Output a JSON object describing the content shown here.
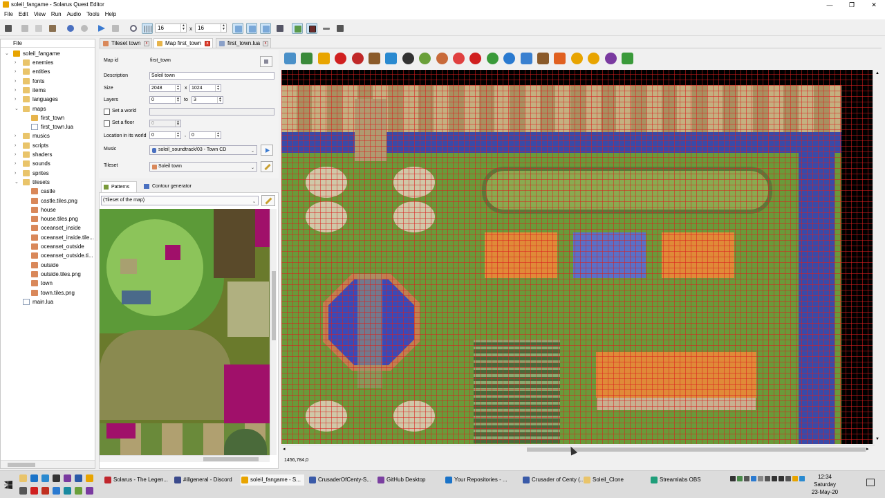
{
  "window": {
    "title": "soleil_fangame - Solarus Quest Editor",
    "min": "—",
    "max": "❐",
    "close": "✕"
  },
  "menu": [
    "File",
    "Edit",
    "View",
    "Run",
    "Audio",
    "Tools",
    "Help"
  ],
  "toolbar": {
    "grid_w": "16",
    "grid_h": "16",
    "x_label": "x"
  },
  "tree": {
    "header": "File",
    "root": "soleil_fangame",
    "items": [
      {
        "label": "enemies",
        "level": 1,
        "kind": "folder",
        "arrow": "›"
      },
      {
        "label": "entities",
        "level": 1,
        "kind": "folder",
        "arrow": "›"
      },
      {
        "label": "fonts",
        "level": 1,
        "kind": "folder",
        "arrow": "›"
      },
      {
        "label": "items",
        "level": 1,
        "kind": "folder",
        "arrow": "›"
      },
      {
        "label": "languages",
        "level": 1,
        "kind": "folder",
        "arrow": "›"
      },
      {
        "label": "maps",
        "level": 1,
        "kind": "folder",
        "arrow": "⌄"
      },
      {
        "label": "first_town",
        "level": 2,
        "kind": "map",
        "arrow": ""
      },
      {
        "label": "first_town.lua",
        "level": 2,
        "kind": "file",
        "arrow": ""
      },
      {
        "label": "musics",
        "level": 1,
        "kind": "folder",
        "arrow": "›"
      },
      {
        "label": "scripts",
        "level": 1,
        "kind": "folder",
        "arrow": "›"
      },
      {
        "label": "shaders",
        "level": 1,
        "kind": "folder",
        "arrow": "›"
      },
      {
        "label": "sounds",
        "level": 1,
        "kind": "folder",
        "arrow": "›"
      },
      {
        "label": "sprites",
        "level": 1,
        "kind": "folder",
        "arrow": "›"
      },
      {
        "label": "tilesets",
        "level": 1,
        "kind": "folder",
        "arrow": "⌄"
      },
      {
        "label": "castle",
        "level": 2,
        "kind": "img",
        "arrow": ""
      },
      {
        "label": "castle.tiles.png",
        "level": 2,
        "kind": "img",
        "arrow": ""
      },
      {
        "label": "house",
        "level": 2,
        "kind": "img",
        "arrow": ""
      },
      {
        "label": "house.tiles.png",
        "level": 2,
        "kind": "img",
        "arrow": ""
      },
      {
        "label": "oceanset_inside",
        "level": 2,
        "kind": "img",
        "arrow": ""
      },
      {
        "label": "oceanset_inside.tile...",
        "level": 2,
        "kind": "img",
        "arrow": ""
      },
      {
        "label": "oceanset_outside",
        "level": 2,
        "kind": "img",
        "arrow": ""
      },
      {
        "label": "oceanset_outside.ti...",
        "level": 2,
        "kind": "img",
        "arrow": ""
      },
      {
        "label": "outside",
        "level": 2,
        "kind": "img",
        "arrow": ""
      },
      {
        "label": "outside.tiles.png",
        "level": 2,
        "kind": "img",
        "arrow": ""
      },
      {
        "label": "town",
        "level": 2,
        "kind": "img",
        "arrow": ""
      },
      {
        "label": "town.tiles.png",
        "level": 2,
        "kind": "img",
        "arrow": ""
      },
      {
        "label": "main.lua",
        "level": 1,
        "kind": "file",
        "arrow": ""
      }
    ]
  },
  "tabs": [
    {
      "label": "Tileset town",
      "icon": "#d9885a"
    },
    {
      "label": "Map first_town",
      "icon": "#e7b44b"
    },
    {
      "label": "first_town.lua",
      "icon": "#8aa0c8"
    }
  ],
  "props": {
    "map_id_label": "Map id",
    "map_id": "first_town",
    "desc_label": "Description",
    "desc": "Soleil town",
    "size_label": "Size",
    "size_w": "2048",
    "size_x": "x",
    "size_h": "1024",
    "layers_label": "Layers",
    "layer_min": "0",
    "layers_to": "to",
    "layer_max": "3",
    "world_label": "Set a world",
    "floor_label": "Set a floor",
    "floor_val": "0",
    "loc_label": "Location in its world",
    "loc_x": "0",
    "loc_comma": ",",
    "loc_y": "0",
    "music_label": "Music",
    "music": "soleil_soundtrack/03 - Town CD",
    "tileset_label": "Tileset",
    "tileset": "Soleil town"
  },
  "patterns": {
    "tab1": "Patterns",
    "tab2": "Contour generator",
    "combo": "(Tileset of the map)"
  },
  "status": {
    "coords": "1456,784,0"
  },
  "taskbar": {
    "items": [
      {
        "label": "Solarus - The Legen...",
        "color": "#c0262d"
      },
      {
        "label": "#illgeneral - Discord",
        "color": "#3b4a8c"
      },
      {
        "label": "soleil_fangame - S...",
        "color": "#e8a400"
      },
      {
        "label": "CrusaderOfCenty-S...",
        "color": "#3a5aa8"
      },
      {
        "label": "GitHub Desktop",
        "color": "#7a3fa0"
      },
      {
        "label": "Your Repositories - ...",
        "color": "#1a73c8"
      },
      {
        "label": "Crusader of Centy (...",
        "color": "#3a5aa8"
      },
      {
        "label": "Soleil_Clone",
        "color": "#e9c46a"
      },
      {
        "label": "Streamlabs OBS",
        "color": "#1f9e7a"
      }
    ],
    "time": "12:34",
    "day": "Saturday",
    "date": "23-May-20"
  }
}
